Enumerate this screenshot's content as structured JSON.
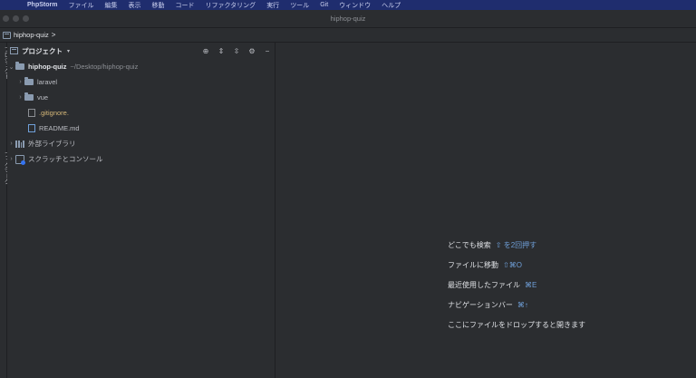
{
  "menubar": {
    "apple": "",
    "items": [
      "PhpStorm",
      "ファイル",
      "編集",
      "表示",
      "移動",
      "コード",
      "リファクタリング",
      "実行",
      "ツール",
      "Git",
      "ウィンドウ",
      "ヘルプ"
    ]
  },
  "window": {
    "title": "hiphop-quiz"
  },
  "navbar": {
    "crumb": "hiphop-quiz",
    "sep": ">"
  },
  "stripe": {
    "label_top": "プロジェクト",
    "label_bottom": "ブックマーク"
  },
  "panel": {
    "title": "プロジェクト",
    "dropdown": "▾",
    "tools": [
      "⊕",
      "⇕",
      "⇳",
      "⚙",
      "−"
    ]
  },
  "tree": {
    "root": {
      "name": "hiphop-quiz",
      "path": "~/Desktop/hiphop-quiz"
    },
    "laravel": "laravel",
    "vue": "vue",
    "gitignore": ".gitignore.",
    "readme": "README.md",
    "ext_libs": "外部ライブラリ",
    "scratches": "スクラッチとコンソール"
  },
  "editor": {
    "hints": [
      {
        "text": "どこでも検索",
        "shortcut": "⇧ を2回押す"
      },
      {
        "text": "ファイルに移動",
        "shortcut": "⇧⌘O"
      },
      {
        "text": "最近使用したファイル",
        "shortcut": "⌘E"
      },
      {
        "text": "ナビゲーションバー",
        "shortcut": "⌘↑"
      },
      {
        "text": "ここにファイルをドロップすると開きます",
        "shortcut": ""
      }
    ]
  },
  "colors": {
    "menubar_bg": "#1f2d6e",
    "panel_bg": "#2b2d30",
    "accent": "#6f9fd8",
    "gitignore": "#d5b778"
  }
}
